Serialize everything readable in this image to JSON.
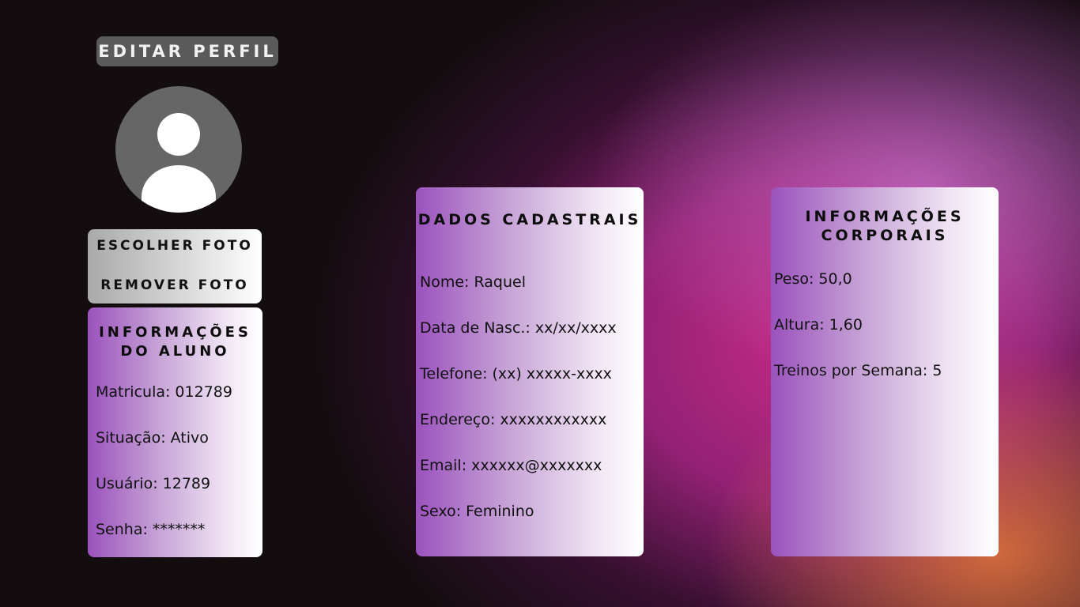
{
  "header": {
    "title": "EDITAR PERFIL"
  },
  "avatar": {
    "icon": "user-silhouette-icon"
  },
  "photo_actions": {
    "choose_label": "ESCOLHER FOTO",
    "remove_label": "REMOVER FOTO"
  },
  "student_info": {
    "title_line1": "INFORMAÇÕES",
    "title_line2": "DO ALUNO",
    "fields": [
      "Matricula: 012789",
      "Situação: Ativo",
      "Usuário: 12789",
      "Senha: *******"
    ]
  },
  "registration": {
    "title": "DADOS CADASTRAIS",
    "fields": [
      "Nome: Raquel",
      "Data de Nasc.: xx/xx/xxxx",
      "Telefone: (xx) xxxxx-xxxx",
      "Endereço: xxxxxxxxxxxx",
      "Email: xxxxxx@xxxxxxx",
      "Sexo:  Feminino"
    ]
  },
  "body_info": {
    "title_line1": "INFORMAÇÕES",
    "title_line2": "CORPORAIS",
    "fields": [
      "Peso: 50,0",
      "Altura: 1,60",
      "Treinos por Semana: 5"
    ]
  },
  "colors": {
    "background": "#140d10",
    "card_gradient_start": "#9b52bd",
    "card_gradient_end": "#ffffff",
    "header_bg": "#5a5a5a",
    "avatar_bg": "#666666"
  }
}
